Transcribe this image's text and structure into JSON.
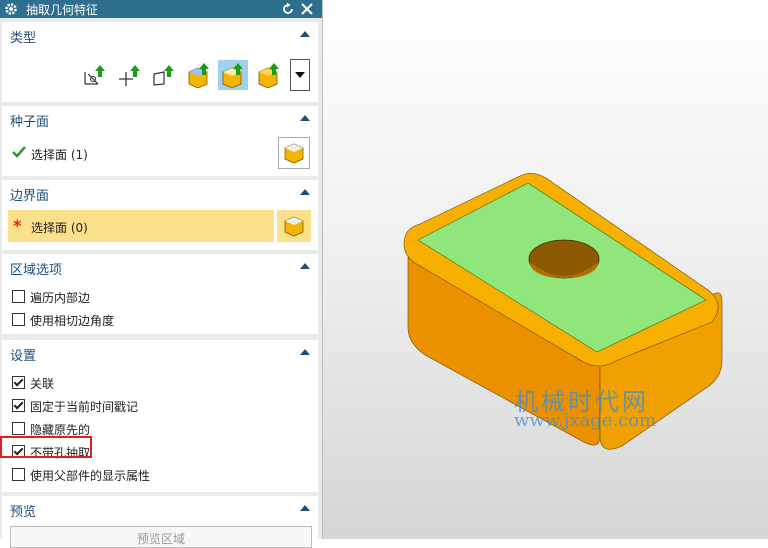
{
  "dialog": {
    "title": "抽取几何特征",
    "type_section": {
      "label": "类型"
    },
    "seed_section": {
      "label": "种子面",
      "select_face": "选择面 (1)"
    },
    "boundary_section": {
      "label": "边界面",
      "select_face": "选择面 (0)"
    },
    "region_section": {
      "label": "区域选项",
      "options": [
        {
          "label": "遍历内部边",
          "checked": false
        },
        {
          "label": "使用相切边角度",
          "checked": false
        }
      ]
    },
    "settings_section": {
      "label": "设置",
      "options": [
        {
          "label": "关联",
          "checked": true
        },
        {
          "label": "固定于当前时间戳记",
          "checked": true
        },
        {
          "label": "隐藏原先的",
          "checked": false
        },
        {
          "label": "不带孔抽取",
          "checked": true
        },
        {
          "label": "使用父部件的显示属性",
          "checked": false
        }
      ]
    },
    "preview_section": {
      "label": "预览",
      "button": "预览区域"
    }
  },
  "watermark": {
    "line1": "机械时代网",
    "line2": "www.jxage.com"
  },
  "colors": {
    "title_bar": "#2e6f8f",
    "selected_face": "#90e67a",
    "body": "#f2a400",
    "highlight_box": "#e02020"
  }
}
